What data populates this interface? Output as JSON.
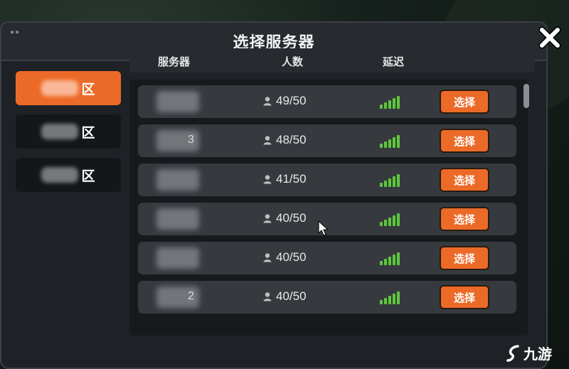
{
  "dialog": {
    "title": "选择服务器",
    "close_icon": "close-icon"
  },
  "regions": [
    {
      "label": "区",
      "selected": true
    },
    {
      "label": "区",
      "selected": false
    },
    {
      "label": "区",
      "selected": false
    }
  ],
  "table": {
    "headers": {
      "server": "服务器",
      "players": "人数",
      "latency": "延迟"
    },
    "rows": [
      {
        "name_suffix": "",
        "players": "49/50",
        "latency_bars": 5,
        "action": "选择"
      },
      {
        "name_suffix": "3",
        "players": "48/50",
        "latency_bars": 5,
        "action": "选择"
      },
      {
        "name_suffix": "",
        "players": "41/50",
        "latency_bars": 5,
        "action": "选择"
      },
      {
        "name_suffix": "",
        "players": "40/50",
        "latency_bars": 5,
        "action": "选择"
      },
      {
        "name_suffix": "",
        "players": "40/50",
        "latency_bars": 5,
        "action": "选择"
      },
      {
        "name_suffix": "2",
        "players": "40/50",
        "latency_bars": 5,
        "action": "选择"
      }
    ]
  },
  "colors": {
    "accent": "#ec6a27",
    "signal": "#5ec83a",
    "panel": "#1e2227"
  },
  "watermark": {
    "text": "九游"
  }
}
